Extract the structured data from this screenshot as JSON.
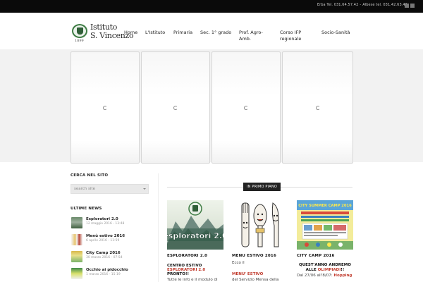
{
  "topbar": {
    "contact_erba": "Erba Tel. 031.64.57.42",
    "separator": "-",
    "contact_albese": "Albese tel. 031.42.63.41",
    "icons": [
      "rss-icon",
      "mail-icon"
    ]
  },
  "logo": {
    "line1": "Istituto",
    "line2": "S. Vincenzo",
    "year": "1899"
  },
  "nav": {
    "items": [
      {
        "label": "Home"
      },
      {
        "label": "L'Istituto"
      },
      {
        "label": "Primaria"
      },
      {
        "label": "Sec. 1° grado"
      },
      {
        "label_line1": "Prof. Agro-",
        "label_line2": "Amb."
      },
      {
        "label_line1": "Corso IFP",
        "label_line2": "regionale"
      },
      {
        "label": "Socio-Sanità"
      }
    ]
  },
  "sidebar": {
    "search_title": "CERCA NEL SITO",
    "search_placeholder": "search site",
    "news_title": "ULTIME NEWS",
    "news": [
      {
        "title": "Esploratori 2.0",
        "date": "12 maggio 2016 - 13:48"
      },
      {
        "title": "Menù estivo 2016",
        "date": "6 aprile 2016 - 11:59"
      },
      {
        "title": "City Camp 2016",
        "date": "30 marzo 2016 - 07:54"
      },
      {
        "title": "Occhio ai pidocchio",
        "date": "1 marzo 2016 - 15:19"
      }
    ]
  },
  "main": {
    "section_label": "IN PRIMO PIANO",
    "cards": [
      {
        "title": "ESPLORATORI 2.0",
        "image_text": "esploratori 2.0",
        "line1": "CENTRO ESTIVO",
        "line2": "ESPLORATORI 2.0",
        "line3": "PRONTO!!",
        "line4": "Tutte le info e il modulo di"
      },
      {
        "title": "MENU ESTIVO 2016",
        "line1": "Ecco il",
        "line2": "MENU' ESTIVO",
        "line3": "del Servizio Mensa della"
      },
      {
        "title": "CITY CAMP 2016",
        "image_text": "CITY SUMMER CAMP 2016",
        "line1": "QUEST'ANNO ANDREMO",
        "line2_pre": "ALLE ",
        "line2_red": "OLIMPIADI",
        "line2_post": "!!",
        "line3_pre": "Dal 27/06 all'8/07: ",
        "line3_red": "Hopping"
      }
    ]
  },
  "colors": {
    "topbar": "#0a0a0a",
    "accent_red": "#c0392b",
    "logo_green": "#3f7d45"
  }
}
